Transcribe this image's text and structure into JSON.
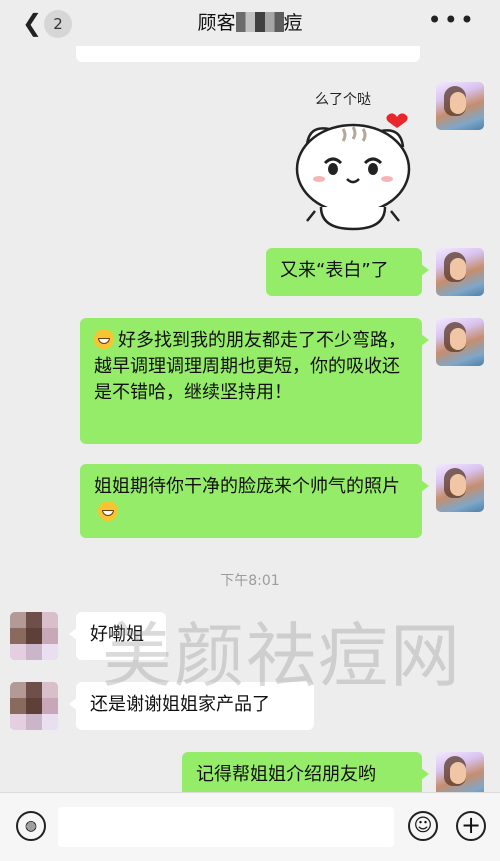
{
  "header": {
    "back_badge": "2",
    "title_prefix": "顾客",
    "title_suffix": "痘",
    "more_label": "•••"
  },
  "sticker": {
    "caption": "么了个哒"
  },
  "messages": [
    {
      "side": "me",
      "text": "又来“表白”了"
    },
    {
      "side": "me",
      "text": "好多找到我的朋友都走了不少弯路，越早调理调理周期也更短，你的吸收还是不错哈，继续坚持用！",
      "emoji": "grin-emoji"
    },
    {
      "side": "me",
      "text": "姐姐期待你干净的脸庞来个帅气的照片",
      "emoji": "grin-emoji"
    },
    {
      "side": "them",
      "text": "好嘞姐"
    },
    {
      "side": "them",
      "text": "还是谢谢姐姐家产品了"
    },
    {
      "side": "me",
      "text": "记得帮姐姐介绍朋友哟"
    }
  ],
  "timestamp": "下午8:01",
  "watermark": "美颜祛痘网",
  "input": {
    "value": "",
    "placeholder": ""
  },
  "colors": {
    "my_bubble": "#95ec69",
    "their_bubble": "#ffffff",
    "background": "#ededed"
  },
  "icons": [
    "back-chevron-icon",
    "more-dots-icon",
    "voice-icon",
    "emoji-icon",
    "plus-icon"
  ]
}
